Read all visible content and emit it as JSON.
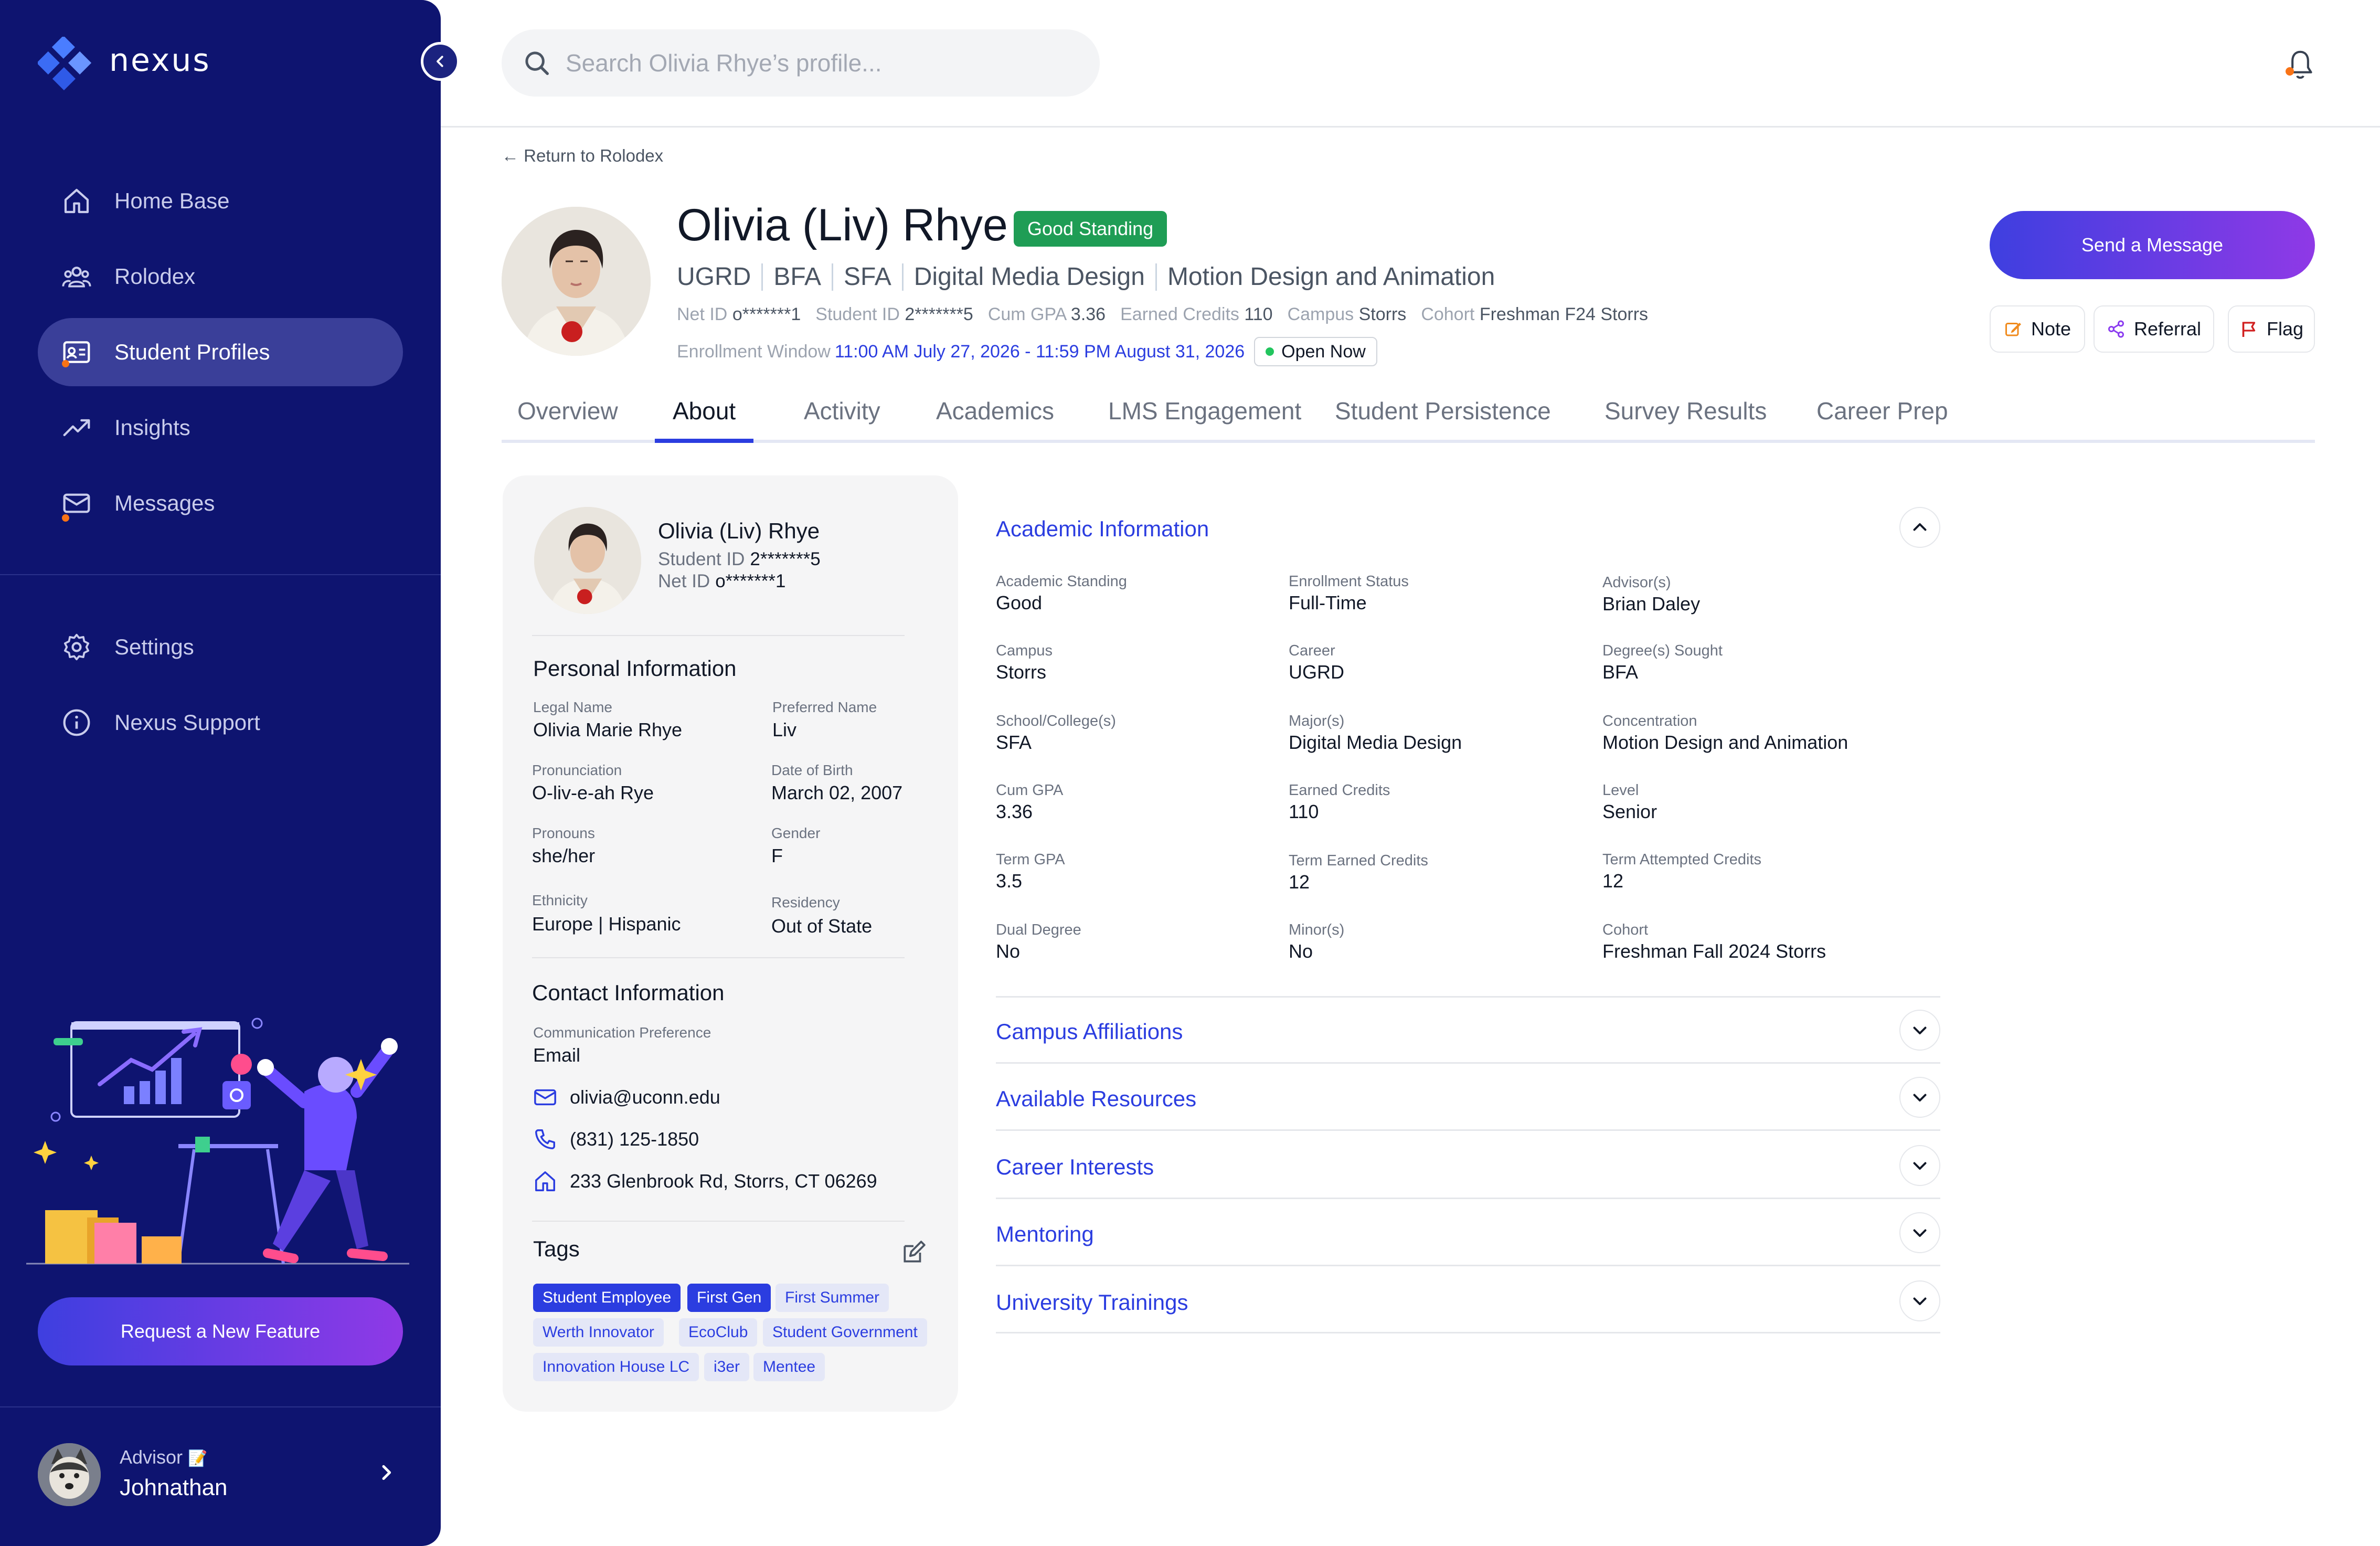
{
  "app": {
    "name": "nexus"
  },
  "sidebar": {
    "nav": [
      {
        "label": "Home Base",
        "icon": "home-icon"
      },
      {
        "label": "Rolodex",
        "icon": "users-icon"
      },
      {
        "label": "Student Profiles",
        "icon": "id-card-icon",
        "active": true
      },
      {
        "label": "Insights",
        "icon": "trend-icon"
      },
      {
        "label": "Messages",
        "icon": "mail-icon"
      }
    ],
    "secondary": [
      {
        "label": "Settings",
        "icon": "gear-icon"
      },
      {
        "label": "Nexus Support",
        "icon": "info-icon"
      }
    ],
    "request_button": "Request a New Feature",
    "advisor": {
      "role": "Advisor",
      "name": "Johnathan"
    }
  },
  "topbar": {
    "search_placeholder": "Search Olivia Rhye’s profile..."
  },
  "profile": {
    "back_link": "← Return to Rolodex",
    "name": "Olivia (Liv) Rhye",
    "standing_badge": "Good Standing",
    "program": [
      "UGRD",
      "BFA",
      "SFA",
      "Digital Media Design",
      "Motion Design and Animation"
    ],
    "meta": [
      {
        "label": "Net ID",
        "value": "o*******1"
      },
      {
        "label": "Student ID",
        "value": "2*******5"
      },
      {
        "label": "Cum GPA",
        "value": "3.36"
      },
      {
        "label": "Earned Credits",
        "value": "110"
      },
      {
        "label": "Campus",
        "value": "Storrs"
      },
      {
        "label": "Cohort",
        "value": "Freshman F24 Storrs"
      }
    ],
    "enrollment_label": "Enrollment Window",
    "enrollment_window": "11:00 AM July 27, 2026 - 11:59 PM August 31, 2026",
    "enrollment_status": "Open Now",
    "send_message": "Send a Message",
    "actions": {
      "note": "Note",
      "referral": "Referral",
      "flag": "Flag"
    }
  },
  "tabs": [
    "Overview",
    "About",
    "Activity",
    "Academics",
    "LMS Engagement",
    "Student Persistence",
    "Survey Results",
    "Career Prep"
  ],
  "active_tab": "About",
  "card": {
    "name": "Olivia (Liv) Rhye",
    "student_id_label": "Student ID",
    "student_id": "2*******5",
    "net_id_label": "Net ID",
    "net_id": "o*******1",
    "personal_title": "Personal Information",
    "personal": [
      {
        "label": "Legal Name",
        "value": "Olivia Marie Rhye"
      },
      {
        "label": "Preferred Name",
        "value": "Liv"
      },
      {
        "label": "Pronunciation",
        "value": "O-liv-e-ah Rye"
      },
      {
        "label": "Date of Birth",
        "value": "March 02, 2007"
      },
      {
        "label": "Pronouns",
        "value": "she/her"
      },
      {
        "label": "Gender",
        "value": "F"
      },
      {
        "label": "Ethnicity",
        "value": "Europe | Hispanic"
      },
      {
        "label": "Residency",
        "value": "Out of State"
      }
    ],
    "contact_title": "Contact Information",
    "comm_pref_label": "Communication Preference",
    "comm_pref": "Email",
    "email": "olivia@uconn.edu",
    "phone": "(831) 125-1850",
    "address": "233 Glenbrook Rd, Storrs, CT 06269",
    "tags_title": "Tags",
    "tags": [
      {
        "label": "Student Employee",
        "active": true
      },
      {
        "label": "First Gen",
        "active": true
      },
      {
        "label": "First Summer",
        "active": false
      },
      {
        "label": "Werth Innovator",
        "active": false
      },
      {
        "label": "EcoClub",
        "active": false
      },
      {
        "label": "Student Government",
        "active": false
      },
      {
        "label": "Innovation House LC",
        "active": false
      },
      {
        "label": "i3er",
        "active": false
      },
      {
        "label": "Mentee",
        "active": false
      }
    ]
  },
  "academic": {
    "title": "Academic Information",
    "fields": [
      {
        "label": "Academic Standing",
        "value": "Good"
      },
      {
        "label": "Enrollment Status",
        "value": "Full-Time"
      },
      {
        "label": "Advisor(s)",
        "value": "Brian Daley"
      },
      {
        "label": "Campus",
        "value": "Storrs"
      },
      {
        "label": "Career",
        "value": "UGRD"
      },
      {
        "label": "Degree(s) Sought",
        "value": "BFA"
      },
      {
        "label": "School/College(s)",
        "value": "SFA"
      },
      {
        "label": "Major(s)",
        "value": "Digital Media Design"
      },
      {
        "label": "Concentration",
        "value": "Motion Design and Animation"
      },
      {
        "label": "Cum GPA",
        "value": "3.36"
      },
      {
        "label": "Earned Credits",
        "value": "110"
      },
      {
        "label": "Level",
        "value": "Senior"
      },
      {
        "label": "Term GPA",
        "value": "3.5"
      },
      {
        "label": "Term Earned Credits",
        "value": "12"
      },
      {
        "label": "Term Attempted Credits",
        "value": "12"
      },
      {
        "label": "Dual Degree",
        "value": "No"
      },
      {
        "label": "Minor(s)",
        "value": "No"
      },
      {
        "label": "Cohort",
        "value": "Freshman Fall 2024 Storrs"
      }
    ]
  },
  "accordions": [
    "Campus Affiliations",
    "Available Resources",
    "Career Interests",
    "Mentoring",
    "University Trainings"
  ],
  "colors": {
    "sidebar": "#0e1470",
    "accent": "#2b3de0",
    "good": "#1f9d55",
    "gradient_start": "#3e3fe0",
    "gradient_end": "#8f39e6"
  }
}
